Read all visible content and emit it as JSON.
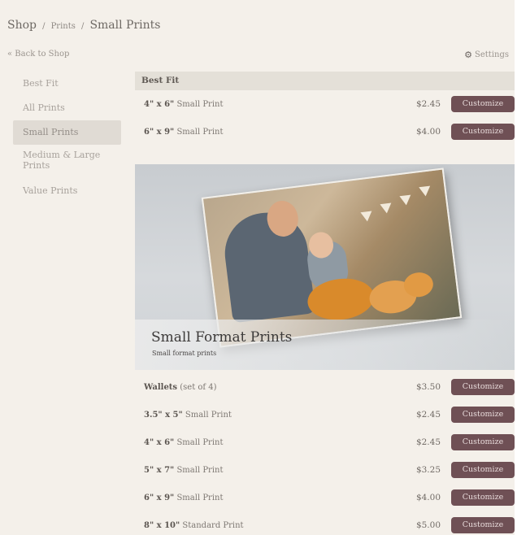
{
  "breadcrumb": {
    "shop": "Shop",
    "prints": "Prints",
    "current": "Small Prints",
    "separator": "/"
  },
  "back_link": "« Back to Shop",
  "settings_label": "Settings",
  "sidebar": {
    "items": [
      {
        "label": "Best Fit",
        "active": false
      },
      {
        "label": "All Prints",
        "active": false
      },
      {
        "label": "Small Prints",
        "active": true
      },
      {
        "label": "Medium & Large Prints",
        "active": false
      },
      {
        "label": "Value Prints",
        "active": false
      }
    ]
  },
  "best_fit": {
    "header": "Best Fit",
    "rows": [
      {
        "size": "4\" x 6\"",
        "desc": "Small Print",
        "price": "$2.45",
        "button": "Customize"
      },
      {
        "size": "6\" x 9\"",
        "desc": "Small Print",
        "price": "$4.00",
        "button": "Customize"
      }
    ]
  },
  "banner": {
    "title": "Small Format Prints",
    "subtitle": "Small format prints"
  },
  "products": {
    "rows": [
      {
        "size": "Wallets",
        "desc": "(set of 4)",
        "price": "$3.50",
        "button": "Customize"
      },
      {
        "size": "3.5\" x 5\"",
        "desc": "Small Print",
        "price": "$2.45",
        "button": "Customize"
      },
      {
        "size": "4\" x 6\"",
        "desc": "Small Print",
        "price": "$2.45",
        "button": "Customize"
      },
      {
        "size": "5\" x 7\"",
        "desc": "Small Print",
        "price": "$3.25",
        "button": "Customize"
      },
      {
        "size": "6\" x 9\"",
        "desc": "Small Print",
        "price": "$4.00",
        "button": "Customize"
      },
      {
        "size": "8\" x 10\"",
        "desc": "Standard Print",
        "price": "$5.00",
        "button": "Customize"
      }
    ]
  },
  "colors": {
    "background": "#f4f0ea",
    "button": "#6f5055",
    "section_header": "#e4e0d8",
    "active_sidebar": "#e0dbd4"
  },
  "icons": {
    "settings": "gear-icon",
    "back": "double-angle-left"
  }
}
